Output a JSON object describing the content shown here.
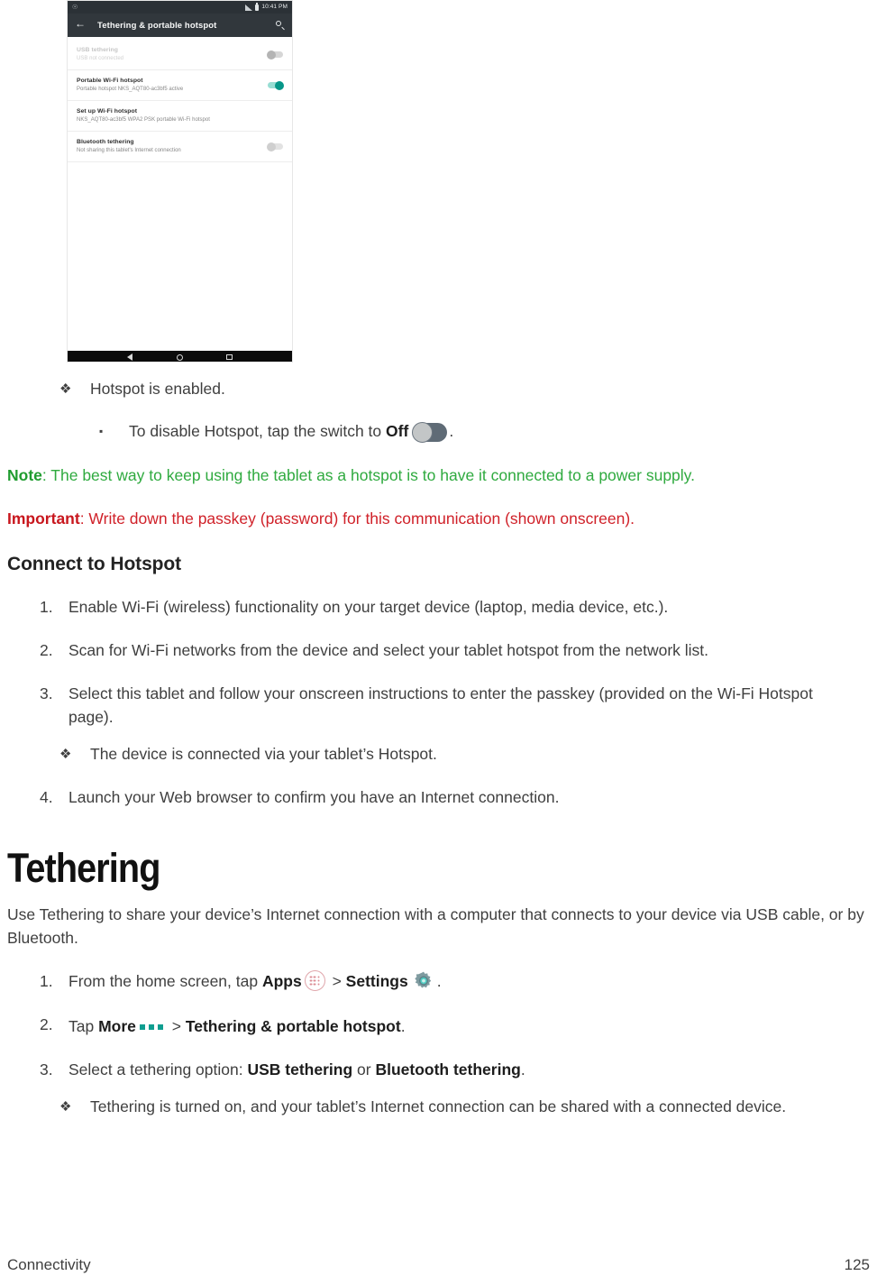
{
  "device_screenshot": {
    "status_bar": {
      "time": "10:41 PM",
      "signal_icon": "signal-icon",
      "battery_icon": "battery-icon",
      "notification_icon": "notification-icon"
    },
    "app_bar": {
      "back_icon": "back-arrow-icon",
      "title": "Tethering & portable hotspot",
      "search_icon": "search-icon"
    },
    "rows": [
      {
        "title": "USB tethering",
        "subtitle": "USB not connected",
        "switch_state": "off",
        "disabled": true
      },
      {
        "title": "Portable Wi-Fi hotspot",
        "subtitle": "Portable hotspot NKS_AQT80-ac3bf5 active",
        "switch_state": "on",
        "disabled": false
      },
      {
        "title": "Set up Wi-Fi hotspot",
        "subtitle": "NKS_AQT80-ac3bf5 WPA2 PSK portable Wi-Fi hotspot",
        "switch_state": "none",
        "disabled": false
      },
      {
        "title": "Bluetooth tethering",
        "subtitle": "Not sharing this tablet's Internet connection",
        "switch_state": "off",
        "disabled": false
      }
    ],
    "nav_bar": {
      "back_icon": "nav-back-icon",
      "home_icon": "nav-home-icon",
      "recents_icon": "nav-recents-icon"
    }
  },
  "content": {
    "bullet_hotspot_enabled": {
      "marker": "❖",
      "text": "Hotspot is enabled."
    },
    "bullet_disable_hotspot": {
      "marker": "▪",
      "prefix": "To disable Hotspot, tap the switch to ",
      "bold": "Off",
      "suffix": ".",
      "icon": "toggle-off-icon"
    },
    "note": {
      "lead": "Note",
      "text": ": The best way to keep using the tablet as a hotspot is to have it connected to a power supply.",
      "color": "#2faa3f"
    },
    "important": {
      "lead": "Important",
      "text": ": Write down the passkey (password) for this communication (shown onscreen).",
      "color": "#d02129"
    },
    "connect_heading": "Connect to Hotspot",
    "connect_steps": [
      {
        "num": "1.",
        "text": "Enable Wi-Fi (wireless) functionality on your target device (laptop, media device, etc.)."
      },
      {
        "num": "2.",
        "text": "Scan for Wi-Fi networks from the device and select your tablet hotspot from the network list."
      },
      {
        "num": "3.",
        "text": "Select this tablet and follow your onscreen instructions to enter the passkey (provided on the Wi-Fi Hotspot page)."
      },
      {
        "num": "4.",
        "text": "Launch your Web browser to confirm you have an Internet connection."
      }
    ],
    "bullet_device_connected": {
      "marker": "❖",
      "text": "The device is connected via your tablet’s Hotspot."
    },
    "tethering_heading": "Tethering",
    "tethering_para": "Use Tethering to share your device’s Internet connection with a computer that connects to your device via USB cable, or by Bluetooth.",
    "tethering_steps": {
      "step1": {
        "num": "1.",
        "part1": "From the home screen, tap ",
        "bold1": "Apps",
        "apps_icon": "apps-icon",
        "sep1": " > ",
        "bold2": "Settings",
        "gear_icon": "gear-icon",
        "tail": "."
      },
      "step2": {
        "num": "2.",
        "part1": "Tap ",
        "bold1": "More",
        "more_icon": "more-dots-icon",
        "sep1": " > ",
        "bold2": "Tethering & portable hotspot",
        "tail": "."
      },
      "step3": {
        "num": "3.",
        "part1": "Select a tethering option: ",
        "bold1": "USB tethering",
        "sep1": " or ",
        "bold2": "Bluetooth tethering",
        "tail": "."
      }
    },
    "bullet_tethering_on": {
      "marker": "❖",
      "text": "Tethering is turned on, and your tablet’s Internet connection can be shared with a connected device."
    }
  },
  "footer": {
    "section": "Connectivity",
    "page_number": "125"
  }
}
